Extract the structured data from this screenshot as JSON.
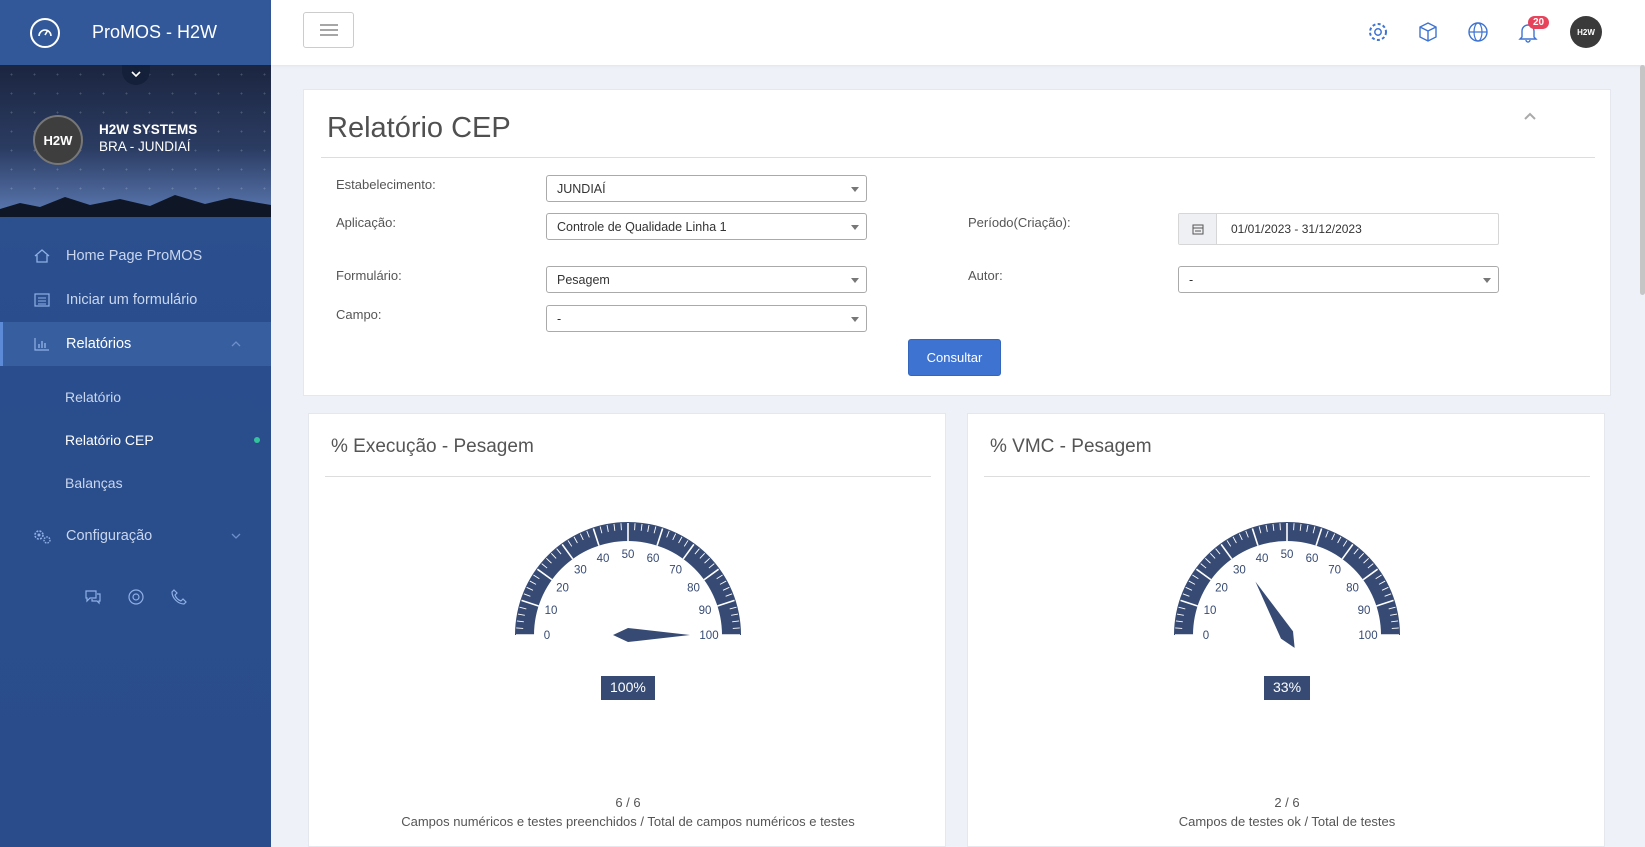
{
  "app": {
    "title": "ProMOS - H2W"
  },
  "profile": {
    "avatar_text": "H2W",
    "company": "H2W SYSTEMS",
    "location": "BRA - JUNDIAÍ"
  },
  "sidebar": {
    "items": [
      {
        "label": "Home Page ProMOS",
        "icon": "home-icon"
      },
      {
        "label": "Iniciar um formulário",
        "icon": "list-icon"
      },
      {
        "label": "Relatórios",
        "icon": "bar-chart-icon"
      },
      {
        "label": "Configuração",
        "icon": "gears-icon"
      }
    ],
    "sub_items": [
      {
        "label": "Relatório"
      },
      {
        "label": "Relatório CEP"
      },
      {
        "label": "Balanças"
      }
    ],
    "footer_icons": [
      "chat-icon",
      "lifebuoy-icon",
      "phone-icon"
    ]
  },
  "topbar": {
    "icons": [
      "gear-icon",
      "cube-icon",
      "globe-icon",
      "bell-icon"
    ],
    "notification_count": "20",
    "user_avatar": "H2W"
  },
  "filter": {
    "title": "Relatório CEP",
    "estabelecimento": {
      "label": "Estabelecimento:",
      "value": "JUNDIAÍ"
    },
    "aplicacao": {
      "label": "Aplicação:",
      "value": "Controle de Qualidade Linha 1"
    },
    "periodo": {
      "label": "Período(Criação):",
      "value": "01/01/2023 - 31/12/2023"
    },
    "formulario": {
      "label": "Formulário:",
      "value": "Pesagem"
    },
    "autor": {
      "label": "Autor:",
      "value": "-"
    },
    "campo": {
      "label": "Campo:",
      "value": "-"
    },
    "submit": "Consultar"
  },
  "gauges": [
    {
      "title": "% Execução - Pesagem",
      "value": 100,
      "value_label": "100%",
      "ratio": "6 / 6",
      "description": "Campos numéricos e testes preenchidos / Total de campos numéricos e testes"
    },
    {
      "title": "% VMC - Pesagem",
      "value": 33,
      "value_label": "33%",
      "ratio": "2 / 6",
      "description": "Campos de testes ok / Total de testes"
    }
  ],
  "gauge_scale": {
    "min": 0,
    "max": 100,
    "ticks": [
      "0",
      "10",
      "20",
      "30",
      "40",
      "50",
      "60",
      "70",
      "80",
      "90",
      "100"
    ],
    "color": "#364a73"
  }
}
